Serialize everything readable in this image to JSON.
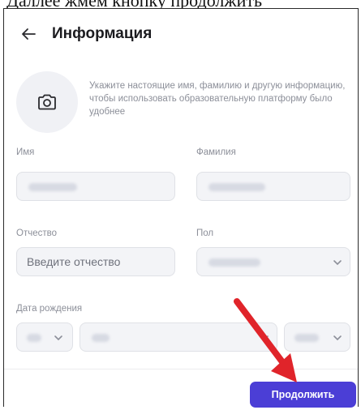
{
  "top_caption": "Даллее жмем кнопку продолжить",
  "header": {
    "title": "Информация"
  },
  "intro": {
    "text": "Укажите настоящие имя, фамилию и другую информацию, чтобы использовать образовательную платформу было удобнее"
  },
  "fields": {
    "first_name": {
      "label": "Имя"
    },
    "last_name": {
      "label": "Фамилия"
    },
    "patronymic": {
      "label": "Отчество",
      "placeholder": "Введите отчество"
    },
    "gender": {
      "label": "Пол"
    },
    "birthdate": {
      "label": "Дата рождения"
    }
  },
  "actions": {
    "continue_label": "Продолжить"
  },
  "colors": {
    "accent": "#4b3ed6",
    "annotation_arrow": "#e0242a",
    "field_bg": "#f3f4f7",
    "muted_text": "#8c8f99"
  },
  "icons": {
    "back": "arrow-left-icon",
    "avatar": "camera-icon",
    "dropdown": "chevron-down-icon"
  }
}
